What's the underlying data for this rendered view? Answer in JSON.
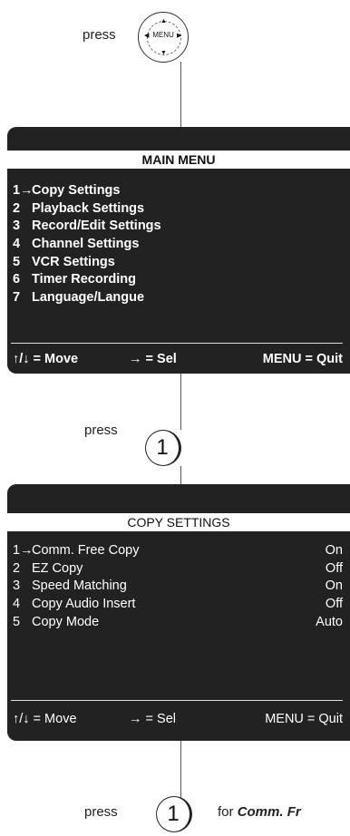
{
  "step1": {
    "press_label": "press",
    "button_label": "MENU"
  },
  "main_menu": {
    "title": "MAIN MENU",
    "items": [
      {
        "num": "1",
        "pointer": "→",
        "label": "Copy Settings"
      },
      {
        "num": "2",
        "label": "Playback Settings"
      },
      {
        "num": "3",
        "label": "Record/Edit Settings"
      },
      {
        "num": "4",
        "label": "Channel Settings"
      },
      {
        "num": "5",
        "label": "VCR Settings"
      },
      {
        "num": "6",
        "label": "Timer Recording"
      },
      {
        "num": "7",
        "label": "Language/Langue"
      }
    ],
    "footer": {
      "move": "↑/↓ = Move",
      "sel": "→ = Sel",
      "quit": "MENU = Quit"
    }
  },
  "step2": {
    "press_label": "press",
    "button_label": "1"
  },
  "copy_settings": {
    "title": "COPY SETTINGS",
    "items": [
      {
        "num": "1",
        "pointer": "→",
        "label": "Comm. Free Copy",
        "value": "On"
      },
      {
        "num": "2",
        "label": "EZ Copy",
        "value": "Off"
      },
      {
        "num": "3",
        "label": "Speed Matching",
        "value": "On"
      },
      {
        "num": "4",
        "label": "Copy Audio Insert",
        "value": "Off"
      },
      {
        "num": "5",
        "label": "Copy Mode",
        "value": "Auto"
      }
    ],
    "footer": {
      "move": "↑/↓ = Move",
      "sel": "→ = Sel",
      "quit": "MENU = Quit"
    }
  },
  "step3": {
    "press_label": "press",
    "button_label": "1",
    "suffix_prefix": "for ",
    "suffix_item": "Comm. Fr"
  },
  "colors": {
    "screen_bg": "#222222",
    "screen_text": "#ffffff",
    "title_bar": "#ffffff",
    "connector": "#555555"
  },
  "icons": [
    "up-arrow",
    "down-arrow",
    "left-arrow",
    "right-arrow"
  ]
}
